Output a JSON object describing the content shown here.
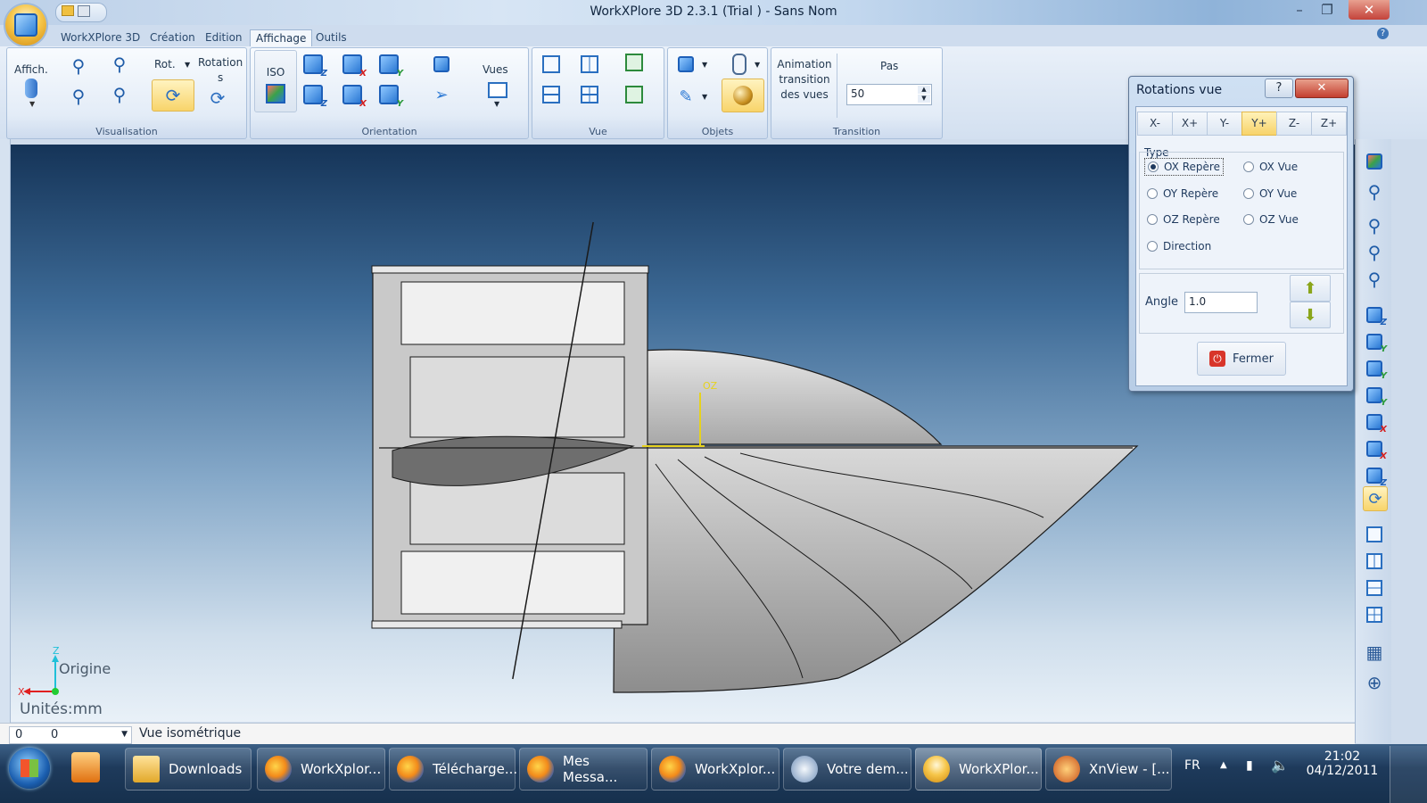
{
  "window": {
    "title": "WorkXPlore 3D 2.3.1 (Trial ) - Sans Nom"
  },
  "menu": {
    "tabs": [
      "WorkXPlore 3D",
      "Création",
      "Edition",
      "Affichage",
      "Outils"
    ],
    "active": "Affichage"
  },
  "ribbon": {
    "visualisation": {
      "label": "Visualisation",
      "affich": "Affich.",
      "rot": "Rot.",
      "rotation_1": "Rotation",
      "rotation_2": "s"
    },
    "orientation": {
      "label": "Orientation",
      "iso": "ISO",
      "vues": "Vues"
    },
    "vue": {
      "label": "Vue"
    },
    "objets": {
      "label": "Objets"
    },
    "transition": {
      "label": "Transition",
      "anim_1": "Animation",
      "anim_2": "transition",
      "anim_3": "des vues",
      "pas_label": "Pas",
      "pas_value": "50"
    }
  },
  "viewport": {
    "units": "Unités:mm",
    "origin": "Origine",
    "axis_z": "Z",
    "axis_x": "X",
    "triad_oz": "OZ"
  },
  "statusbar": {
    "field1": "0",
    "field2": "0",
    "view_mode": "Vue isométrique"
  },
  "dialog": {
    "title": "Rotations vue",
    "help": "?",
    "axis_buttons": [
      "X-",
      "X+",
      "Y-",
      "Y+",
      "Z-",
      "Z+"
    ],
    "selected_axis": "Y+",
    "type_label": "Type",
    "radios": [
      "OX Repère",
      "OX Vue",
      "OY Repère",
      "OY Vue",
      "OZ Repère",
      "OZ Vue",
      "Direction"
    ],
    "selected_radio": "OX Repère",
    "angle_label": "Angle",
    "angle_value": "1.0",
    "close_label": "Fermer"
  },
  "taskbar": {
    "items": [
      "Downloads",
      "WorkXplor...",
      "Télécharge...",
      "Mes Messa...",
      "WorkXplor...",
      "Votre dem...",
      "WorkXPlor...",
      "XnView - [..."
    ],
    "lang": "FR",
    "time": "21:02",
    "date": "04/12/2011"
  }
}
